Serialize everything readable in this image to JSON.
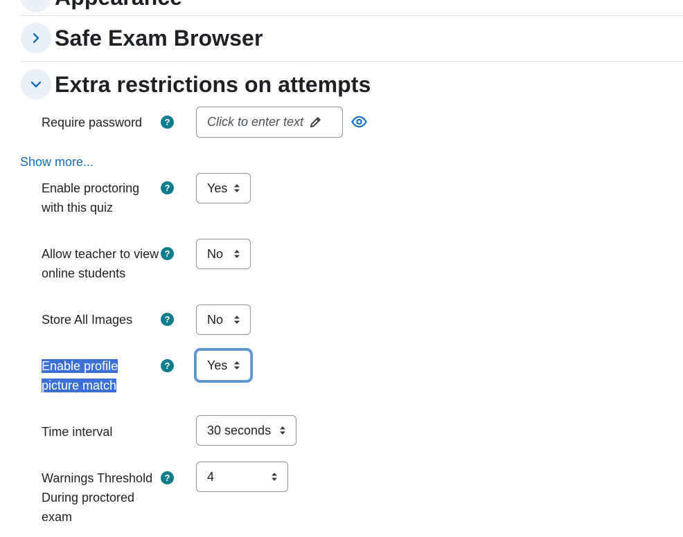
{
  "sections": {
    "appearance_title": "Appearance",
    "safe_exam_title": "Safe Exam Browser",
    "extra_title": "Extra restrictions on attempts"
  },
  "require_password": {
    "label": "Require password",
    "placeholder": "Click to enter text"
  },
  "show_more": "Show more...",
  "fields": {
    "proctoring": {
      "label": "Enable proctoring with this quiz",
      "value": "Yes"
    },
    "teacher_view": {
      "label": "Allow teacher to view online students",
      "value": "No"
    },
    "store_images": {
      "label": "Store All Images",
      "value": "No"
    },
    "profile_match": {
      "label": "Enable profile picture match",
      "value": "Yes"
    },
    "time_interval": {
      "label": "Time interval",
      "value": "30 seconds"
    },
    "warnings": {
      "label": "Warnings Threshold During proctored exam",
      "value": "4"
    }
  },
  "help_glyph": "?",
  "colors": {
    "accent": "#0f7c8c",
    "link": "#0f6cbf",
    "highlight": "#3c6fd6"
  }
}
